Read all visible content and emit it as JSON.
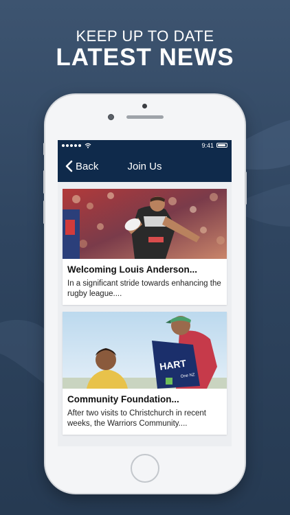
{
  "promo": {
    "line1": "KEEP UP TO DATE",
    "line2": "LATEST NEWS"
  },
  "statusbar": {
    "time": "9:41",
    "battery_level": 0.9
  },
  "navbar": {
    "back_label": "Back",
    "title": "Join Us"
  },
  "articles": [
    {
      "title": "Welcoming Louis Anderson...",
      "excerpt": "In a significant stride towards enhancing the rugby league....",
      "image_icon": "rugby-player-photo"
    },
    {
      "title": "Community Foundation...",
      "excerpt": "After two visits to Christchurch in recent weeks, the Warriors Community....",
      "image_icon": "community-training-photo",
      "image_text": {
        "brand": "HART",
        "sub": "One NZ"
      }
    }
  ],
  "colors": {
    "navbar": "#0f2a4b",
    "background": "#2f4560",
    "card": "#ffffff"
  }
}
